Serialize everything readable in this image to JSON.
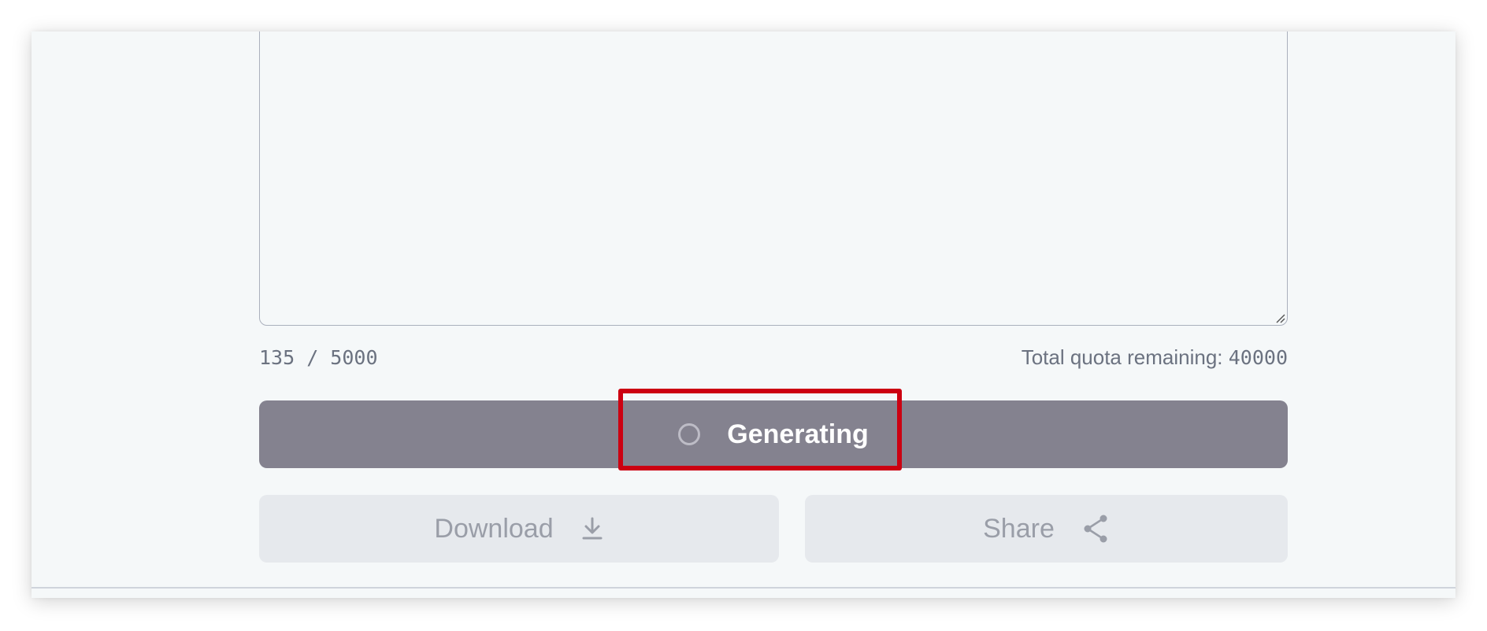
{
  "editor": {
    "char_count": "135 / 5000",
    "quota_label": "Total quota remaining: ",
    "quota_value": "40000"
  },
  "generate_button": {
    "label": "Generating",
    "state": "loading",
    "color": "#84828f"
  },
  "actions": {
    "download_label": "Download",
    "download_icon": "download-icon",
    "share_label": "Share",
    "share_icon": "share-icon"
  },
  "highlight": {
    "color": "#cc0011"
  }
}
